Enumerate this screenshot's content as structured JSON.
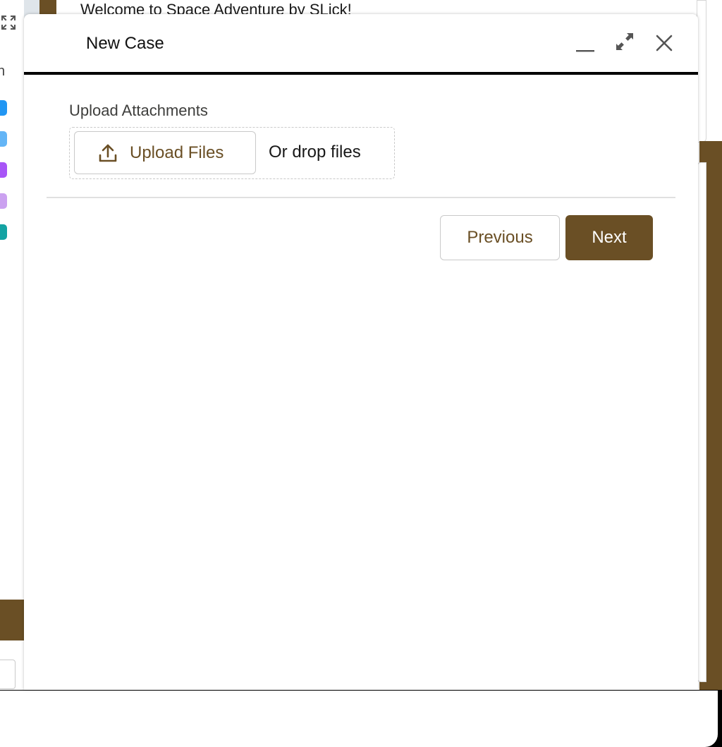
{
  "background": {
    "header_text": "Welcome to Space Adventure by SLick!",
    "sidebar_cut_letter": "n",
    "sidebar_dots": [
      "#2196f3",
      "#64b5f6",
      "#a855f7",
      "#cba1f0",
      "#14a3a3"
    ],
    "accent_color": "#6a4f25"
  },
  "modal": {
    "title": "New Case",
    "header_icons": [
      "minimize-icon",
      "expand-icon",
      "close-icon"
    ],
    "upload": {
      "label": "Upload Attachments",
      "button_label": "Upload Files",
      "drop_text": "Or drop files",
      "icon": "upload-icon"
    },
    "footer": {
      "previous_label": "Previous",
      "next_label": "Next"
    },
    "colors": {
      "brand": "#6a4f25",
      "text": "#111111"
    }
  }
}
